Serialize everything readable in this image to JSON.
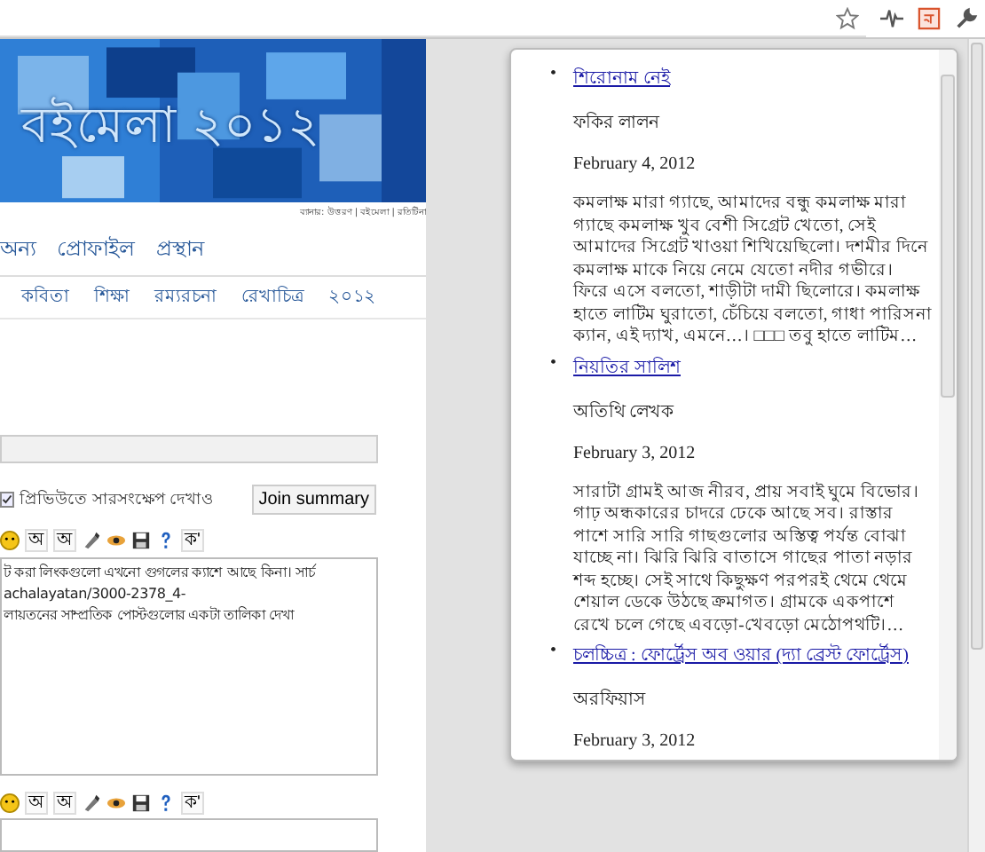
{
  "browser": {
    "toolbar_icons": [
      {
        "kind": "star"
      },
      {
        "kind": "pulse"
      },
      {
        "kind": "extension"
      },
      {
        "kind": "wrench"
      }
    ]
  },
  "page": {
    "banner": {
      "title": "বইমেলা ২০১২",
      "credit": "ব্যানার: উত্তরণ | বইমেলা | রতিটিনা"
    },
    "nav_primary": [
      "অন্য",
      "প্রোফাইল",
      "প্রস্থান"
    ],
    "nav_secondary": [
      "কবিতা",
      "শিক্ষা",
      "রম্যরচনা",
      "রেখাচিত্র",
      "২০১২"
    ],
    "summary_option": {
      "label": "প্রিভিউতে সারসংক্ষেপ দেখাও",
      "checked": true
    },
    "join_button": "Join summary",
    "editor_toolbar": [
      {
        "kind": "smiley"
      },
      {
        "kind": "text",
        "label": "অ"
      },
      {
        "kind": "text",
        "label": "অ"
      },
      {
        "kind": "brush"
      },
      {
        "kind": "eye"
      },
      {
        "kind": "save"
      },
      {
        "kind": "help"
      },
      {
        "kind": "text",
        "label": "ক'"
      }
    ],
    "editor_text": [
      "ট করা লিংকগুলো এখনো গুগলের ক্যাশে আছে কিনা। সার্চ",
      "achalayatan/3000-2378_4-",
      "লায়তনের সাম্প্রতিক পোস্টগুলোর একটা তালিকা দেখা"
    ],
    "second_toolbar": [
      {
        "kind": "smiley"
      },
      {
        "kind": "text",
        "label": "অ"
      },
      {
        "kind": "text",
        "label": "অ"
      },
      {
        "kind": "brush"
      },
      {
        "kind": "eye"
      },
      {
        "kind": "save"
      },
      {
        "kind": "help"
      },
      {
        "kind": "text",
        "label": "ক'"
      }
    ]
  },
  "popup": {
    "items": [
      {
        "marker": "•",
        "title": "শিরোনাম নেই",
        "author": "ফকির লালন",
        "date": "February 4, 2012",
        "excerpt": "কমলাক্ষ মারা গ্যাছে, আমাদের বন্ধু কমলাক্ষ মারা গ্যাছে কমলাক্ষ খুব বেশী সিগ্রেট খেতো, সেই আমাদের সিগ্রেট খাওয়া শিখিয়েছিলো। দশমীর দিনে কমলাক্ষ মাকে নিয়ে নেমে যেতো নদীর গভীরে। ফিরে এসে বলতো, শাড়ীটা দামী ছিলোরে। কমলাক্ষ হাতে লাটিম ঘুরাতো, চেঁচিয়ে বলতো, গাধা পারিসনা ক্যান, এই দ্যাখ, এমনে…। □□□ তবু হাতে লাটিম…"
      },
      {
        "marker": "•",
        "title": "নিয়তির সালিশ",
        "author": "অতিথি লেখক",
        "date": "February 3, 2012",
        "excerpt": "সারাটা গ্রামই আজ নীরব, প্রায় সবাই ঘুমে বিভোর। গাঢ় অন্ধকারের চাদরে ঢেকে আছে সব। রাস্তার পাশে সারি সারি গাছগুলোর অস্তিত্ব পর্যন্ত বোঝা যাচ্ছে না। ঝিরি ঝিরি বাতাসে গাছের পাতা নড়ার শব্দ হচ্ছে। সেই সাথে কিছুক্ষণ পরপরই থেমে থেমে শেয়াল ডেকে উঠছে ক্রমাগত। গ্রামকে একপাশে রেখে চলে গেছে এবড়ো-খেবড়ো মেঠোপথটি।…"
      },
      {
        "marker": "•",
        "title": "চলচ্চিত্র : ফোর্ট্রেস অব ওয়ার (দ্যা ব্রেস্ট ফোর্ট্রেস)",
        "author": "অরফিয়াস",
        "date": "February 3, 2012"
      }
    ]
  }
}
